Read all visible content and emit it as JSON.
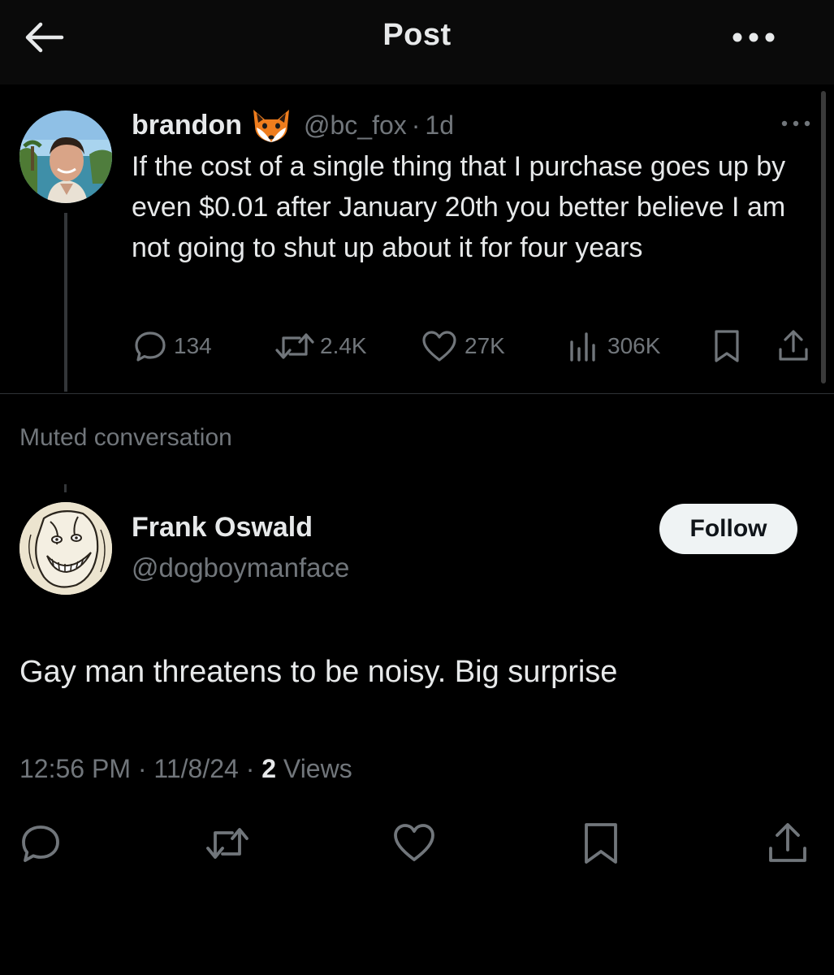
{
  "header": {
    "title": "Post"
  },
  "parent_tweet": {
    "author_name": "brandon",
    "author_emoji": "fox-face",
    "handle": "@bc_fox",
    "separator": "·",
    "time_ago": "1d",
    "text": "If the cost of a single thing that I purchase goes up by even $0.01 after January 20th you better believe I am not going to shut up about it for four years",
    "stats": {
      "replies": "134",
      "reposts": "2.4K",
      "likes": "27K",
      "views": "306K"
    }
  },
  "muted_label": "Muted conversation",
  "reply_tweet": {
    "author_name": "Frank Oswald",
    "handle": "@dogboymanface",
    "follow_label": "Follow",
    "text": "Gay man threatens to be noisy. Big surprise",
    "meta": {
      "time": "12:56 PM",
      "date": "11/8/24",
      "separator": "·",
      "views_count": "2",
      "views_label": "Views"
    }
  },
  "icons": {
    "back": "arrow-left-icon",
    "more": "more-horizontal-icon",
    "reply": "reply-icon",
    "repost": "repost-icon",
    "like": "heart-icon",
    "views": "views-chart-icon",
    "bookmark": "bookmark-icon",
    "share": "share-icon"
  },
  "colors": {
    "background": "#000000",
    "text_primary": "#e7e9ea",
    "text_secondary": "#71767b",
    "follow_button_bg": "#eff3f4",
    "divider": "#2f3336"
  }
}
